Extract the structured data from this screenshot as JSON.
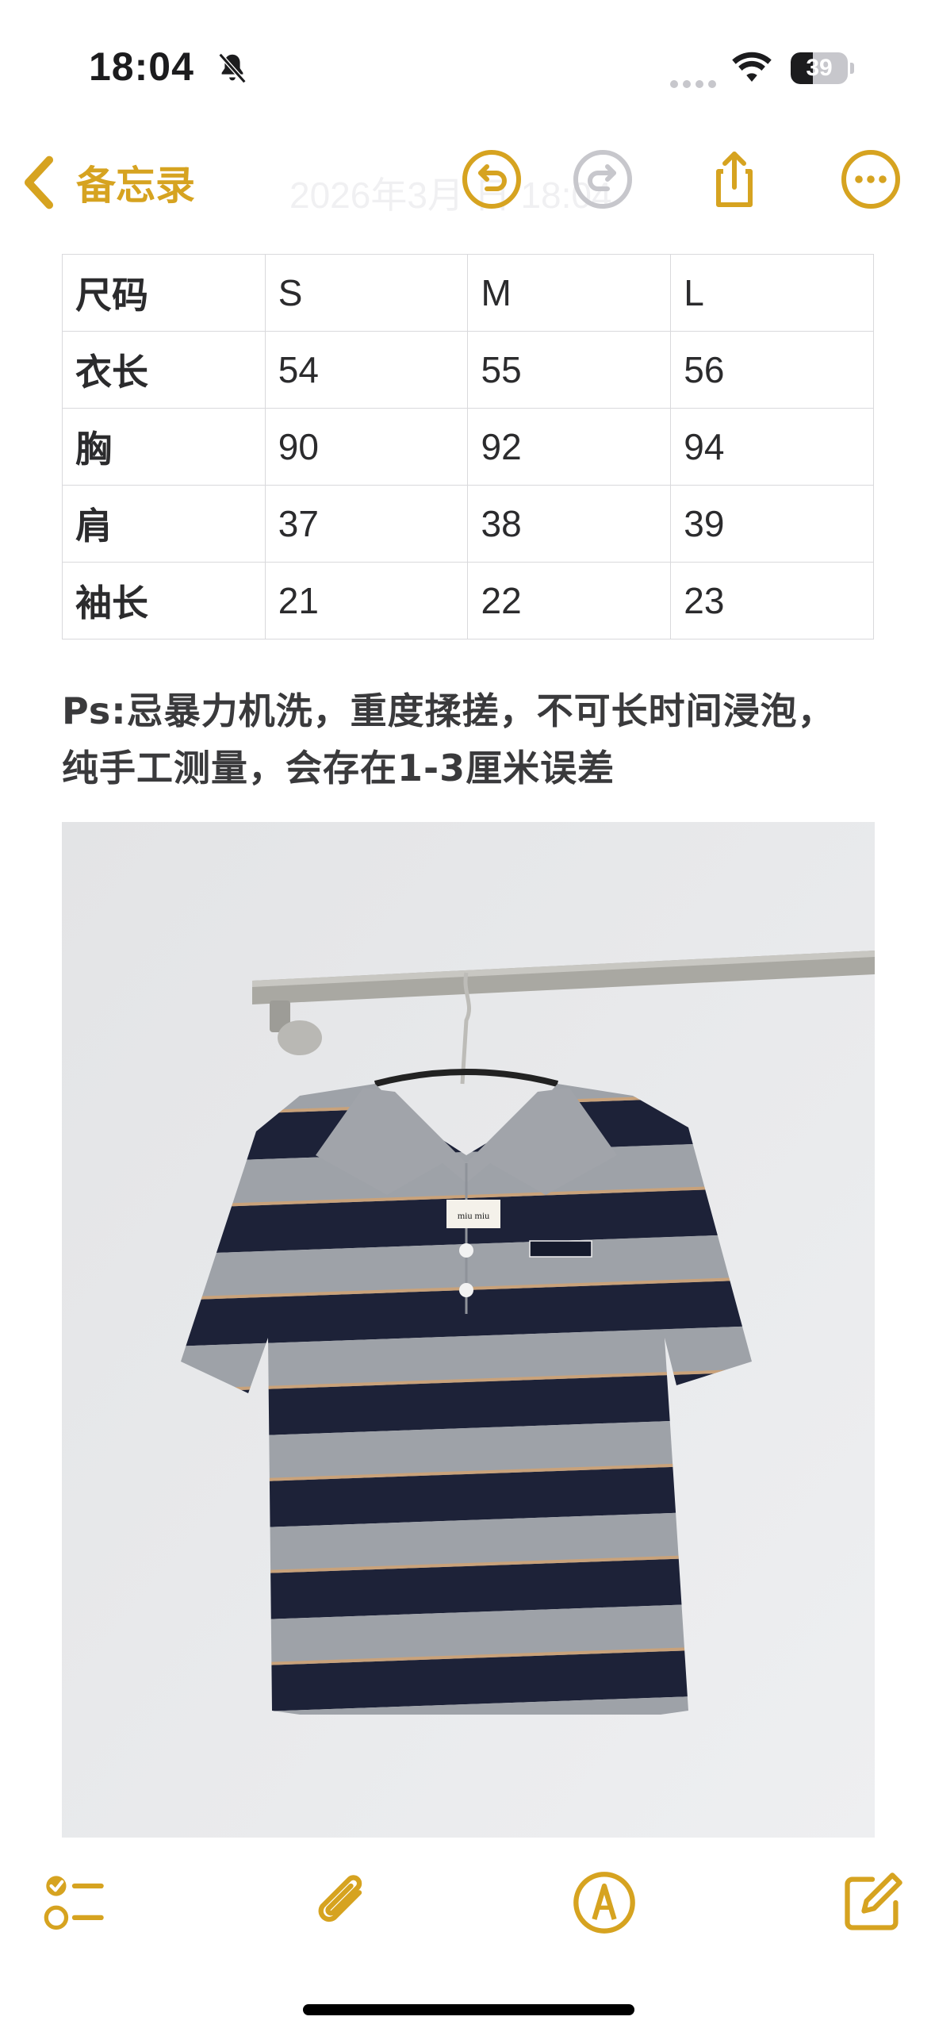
{
  "status_bar": {
    "time": "18:04",
    "battery": "39",
    "battery_level": 0.39,
    "icons": [
      "bell-slash-icon",
      "signal-icon",
      "wifi-icon",
      "battery-icon"
    ]
  },
  "nav": {
    "back_label": "备忘录",
    "date_label": "2026年3月  日 18:04",
    "icons": [
      "chevron-left-icon",
      "undo-icon",
      "redo-icon",
      "share-icon",
      "more-icon"
    ]
  },
  "size_table": {
    "header": [
      "尺码",
      "S",
      "M",
      "L"
    ],
    "rows": [
      [
        "衣长",
        "54",
        "55",
        "56"
      ],
      [
        "胸",
        "90",
        "92",
        "94"
      ],
      [
        "肩",
        "37",
        "38",
        "39"
      ],
      [
        "袖长",
        "21",
        "22",
        "23"
      ]
    ]
  },
  "note": {
    "line1": "Ps:忌暴力机洗，重度揉搓，不可长时间浸泡，",
    "line2": "纯手工测量，会存在1-3厘米误差"
  },
  "photo": {
    "subject_icon": "striped-polo-shirt-photo",
    "label_text": "miu miu"
  },
  "toolbar": {
    "icons": [
      "checklist-icon",
      "paperclip-icon",
      "markup-pen-icon",
      "compose-icon"
    ]
  },
  "colors": {
    "accent": "#d6a320",
    "stripe_navy": "#1d2238",
    "stripe_grey": "#9ea2a8"
  }
}
